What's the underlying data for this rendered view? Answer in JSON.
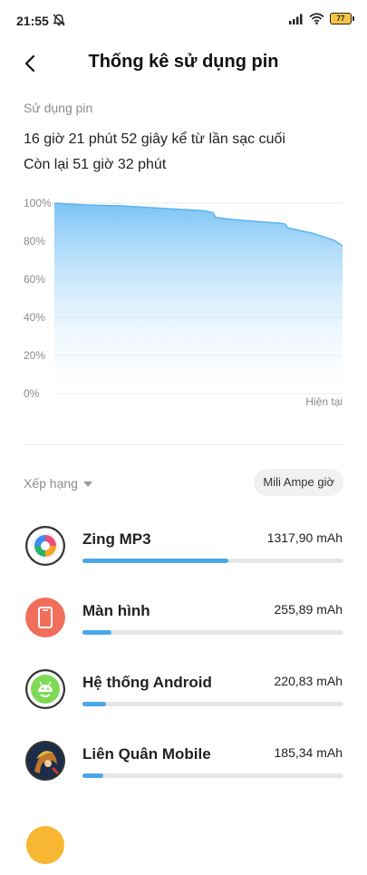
{
  "status_bar": {
    "time": "21:55",
    "battery_level": "77",
    "icons": [
      "alarm-off-icon",
      "signal-icon",
      "wifi-icon",
      "battery-icon"
    ]
  },
  "header": {
    "title": "Thống kê sử dụng pin",
    "back_icon": "back-arrow-icon"
  },
  "summary": {
    "section_label": "Sử dụng pin",
    "since_last_charge": "16 giờ 21 phút 52 giây kể từ lần sạc cuối",
    "remaining": "Còn lại 51 giờ 32 phút"
  },
  "chart_data": {
    "type": "area",
    "y_ticks": [
      "100%",
      "80%",
      "60%",
      "40%",
      "20%",
      "0%"
    ],
    "ylim": [
      0,
      100
    ],
    "xlabel": "Hiện tại",
    "x": [
      0,
      5,
      12,
      24,
      40,
      52,
      55,
      56,
      61,
      73,
      78,
      80,
      81,
      84,
      90,
      97,
      100
    ],
    "values": [
      100,
      99.5,
      99,
      98.5,
      97,
      96,
      95,
      92.5,
      91.5,
      90,
      89.5,
      89,
      87,
      86,
      84,
      80.5,
      77.5
    ],
    "fill_color": "#7cc4f5",
    "line_color": "#5ab4f0",
    "grid": true
  },
  "ranking": {
    "sort_label": "Xếp hạng",
    "unit_button": "Mili Ampe giờ"
  },
  "apps": [
    {
      "name": "Zing MP3",
      "value": "1317,90 mAh",
      "fraction": 0.56,
      "icon": "zing-mp3-icon"
    },
    {
      "name": "Màn hình",
      "value": "255,89 mAh",
      "fraction": 0.11,
      "icon": "screen-icon"
    },
    {
      "name": "Hệ thống Android",
      "value": "220,83 mAh",
      "fraction": 0.09,
      "icon": "android-icon"
    },
    {
      "name": "Liên Quân Mobile",
      "value": "185,34 mAh",
      "fraction": 0.08,
      "icon": "lien-quan-icon"
    }
  ]
}
